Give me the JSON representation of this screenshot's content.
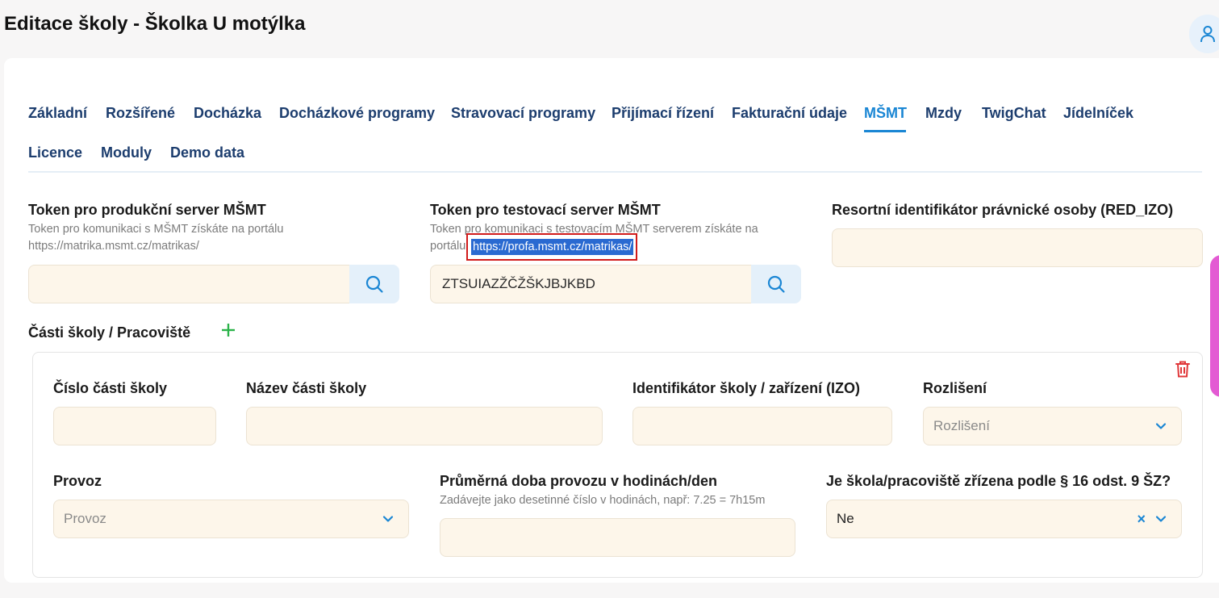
{
  "header": {
    "title": "Editace školy - Školka U motýlka"
  },
  "tabs": [
    {
      "label": "Základní"
    },
    {
      "label": "Rozšířené"
    },
    {
      "label": "Docházka"
    },
    {
      "label": "Docházkové programy"
    },
    {
      "label": "Stravovací programy"
    },
    {
      "label": "Přijímací řízení"
    },
    {
      "label": "Fakturační údaje"
    },
    {
      "label": "MŠMT",
      "active": true
    },
    {
      "label": "Mzdy"
    },
    {
      "label": "TwigChat"
    },
    {
      "label": "Jídelníček"
    },
    {
      "label": "Licence"
    },
    {
      "label": "Moduly"
    },
    {
      "label": "Demo data"
    }
  ],
  "prod_token": {
    "label": "Token pro produkční server MŠMT",
    "help_line1": "Token pro komunikaci s MŠMT získáte na portálu",
    "help_line2": "https://matrika.msmt.cz/matrikas/",
    "value": ""
  },
  "test_token": {
    "label": "Token pro testovací server MŠMT",
    "help_line1": "Token pro komunikaci s testovacím MŠMT serverem získáte na",
    "help_prefix": "portálu",
    "help_link": "https://profa.msmt.cz/matrikas/",
    "value": "ZTSUIAZŽČŽŠKJBJKBD"
  },
  "red_izo": {
    "label": "Resortní identifikátor právnické osoby (RED_IZO)",
    "value": ""
  },
  "parts": {
    "title": "Části školy / Pracoviště",
    "add_symbol": "+",
    "fields": {
      "cislo_label": "Číslo části školy",
      "nazev_label": "Název části školy",
      "izo_label": "Identifikátor školy / zařízení (IZO)",
      "rozliseni_label": "Rozlišení",
      "rozliseni_placeholder": "Rozlišení",
      "provoz_label": "Provoz",
      "provoz_placeholder": "Provoz",
      "doba_label": "Průměrná doba provozu v hodinách/den",
      "doba_help": "Zadávejte jako desetinné číslo v hodinách, např: 7.25 = 7h15m",
      "paragraf_label": "Je škola/pracoviště zřízena podle § 16 odst. 9 ŠZ?",
      "paragraf_value": "Ne",
      "clear_symbol": "×"
    }
  },
  "colors": {
    "accent": "#1a86d4",
    "nav_text": "#1c3d6e",
    "input_bg": "#fdf6ea",
    "highlight_border": "#d11b1b",
    "add_green": "#2bb34a",
    "delete_red": "#e0383a",
    "side_accent": "#e35bd3"
  },
  "icons": [
    "user-icon",
    "search-icon",
    "plus-icon",
    "trash-icon",
    "chevron-down-icon",
    "clear-icon"
  ]
}
